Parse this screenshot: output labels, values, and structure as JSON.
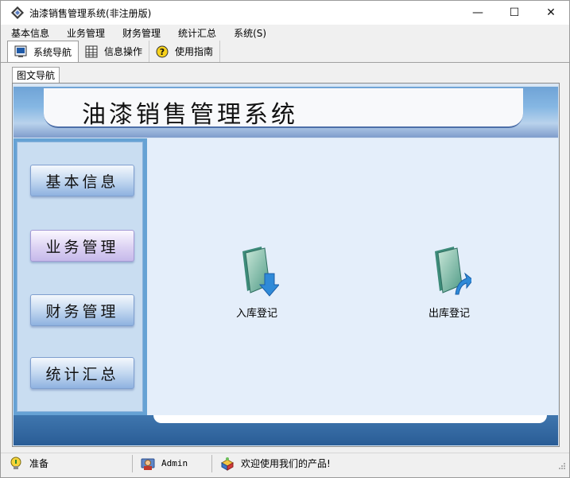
{
  "window": {
    "title": "油漆销售管理系统(非注册版)",
    "controls": {
      "minimize": "—",
      "maximize": "☐",
      "close": "✕"
    }
  },
  "menubar": [
    "基本信息",
    "业务管理",
    "财务管理",
    "统计汇总",
    "系统(S)"
  ],
  "toolbar": [
    {
      "label": "系统导航",
      "icon": "monitor-icon",
      "active": true
    },
    {
      "label": "信息操作",
      "icon": "grid-icon",
      "active": false
    },
    {
      "label": "使用指南",
      "icon": "help-icon",
      "active": false
    }
  ],
  "inner_tab": "图文导航",
  "header": {
    "app_title": "油漆销售管理系统"
  },
  "sidebar": [
    "基本信息",
    "业务管理",
    "财务管理",
    "统计汇总"
  ],
  "launchers": [
    {
      "label": "入库登记",
      "icon": "folder-in-icon"
    },
    {
      "label": "出库登记",
      "icon": "folder-out-icon"
    }
  ],
  "status": {
    "state": "准备",
    "user": "Admin",
    "message": "欢迎使用我们的产品!"
  },
  "colors": {
    "header_blue": "#86b7e3",
    "sidebar_blue": "#66a2d4",
    "footer_blue": "#2a5d96",
    "main_bg": "#e4eefa"
  }
}
